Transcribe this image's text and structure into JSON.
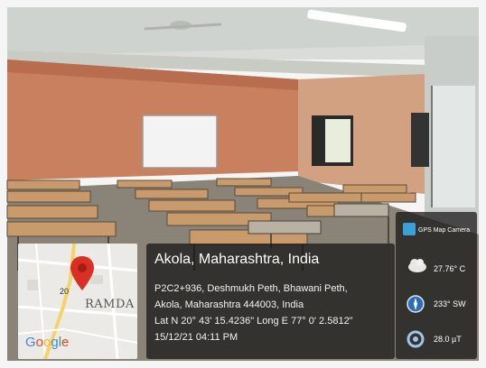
{
  "image_description": "Classroom with rows of wooden desks and benches, a whiteboard on the back wall, ceiling fan and tube light, overlaid with a GPS Map Camera geotag stamp.",
  "geotag": {
    "place_title": "Akola, Maharashtra, India",
    "address_line_1": "P2C2+936, Deshmukh Peth, Bhawani Peth,",
    "address_line_2": "Akola, Maharashtra 444003, India",
    "coordinates": "Lat N 20° 43' 15.4236\" Long E 77° 0' 2.5812\"",
    "timestamp": "15/12/21 04:11 PM"
  },
  "map": {
    "area_label": "RAMDA",
    "route_label": "20",
    "logo": "Google"
  },
  "app": {
    "name": "GPS Map Camera"
  },
  "sensors": {
    "temperature": "27.76° C",
    "wind": "233° SW",
    "magnetic": "28.0 µT"
  }
}
